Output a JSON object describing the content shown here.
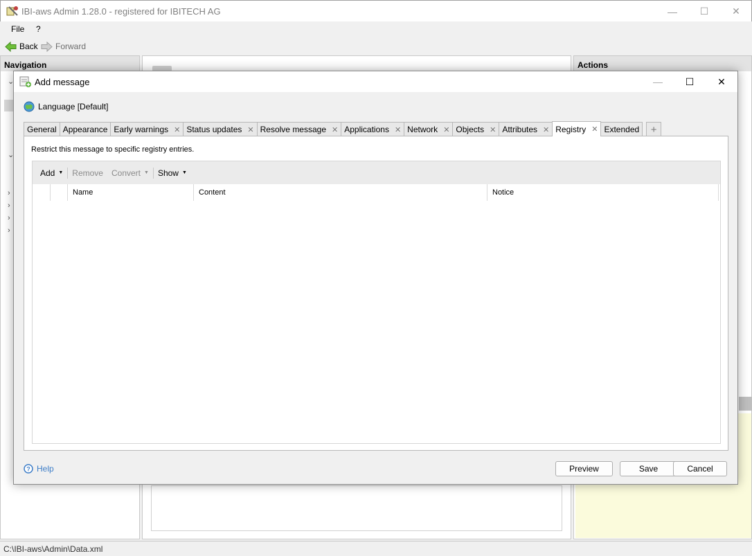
{
  "app": {
    "title": "IBI-aws Admin 1.28.0 - registered for IBITECH AG"
  },
  "menu": {
    "file": "File",
    "help": "?"
  },
  "nav": {
    "back": "Back",
    "forward": "Forward"
  },
  "left_pane": {
    "header": "Navigation"
  },
  "right_pane": {
    "header": "Actions"
  },
  "statusbar": {
    "path": "C:\\IBI-aws\\Admin\\Data.xml"
  },
  "dialog": {
    "title": "Add message",
    "language": "Language [Default]",
    "tabs": [
      {
        "label": "General",
        "closable": false
      },
      {
        "label": "Appearance",
        "closable": false
      },
      {
        "label": "Early warnings",
        "closable": true
      },
      {
        "label": "Status updates",
        "closable": true
      },
      {
        "label": "Resolve message",
        "closable": true
      },
      {
        "label": "Applications",
        "closable": true
      },
      {
        "label": "Network",
        "closable": true
      },
      {
        "label": "Objects",
        "closable": true
      },
      {
        "label": "Attributes",
        "closable": true
      },
      {
        "label": "Registry",
        "closable": true,
        "active": true
      },
      {
        "label": "Extended",
        "closable": false
      }
    ],
    "description": "Restrict this message to specific registry entries.",
    "toolbar": {
      "add": "Add",
      "remove": "Remove",
      "convert": "Convert",
      "show": "Show"
    },
    "columns": {
      "name": "Name",
      "content": "Content",
      "notice": "Notice"
    },
    "help": "Help",
    "buttons": {
      "preview": "Preview",
      "save": "Save",
      "cancel": "Cancel"
    }
  },
  "colors": {
    "help_link": "#3e7ec8",
    "actions_note_bg": "#fbfbdc",
    "tab_active_bg": "#ffffff"
  }
}
